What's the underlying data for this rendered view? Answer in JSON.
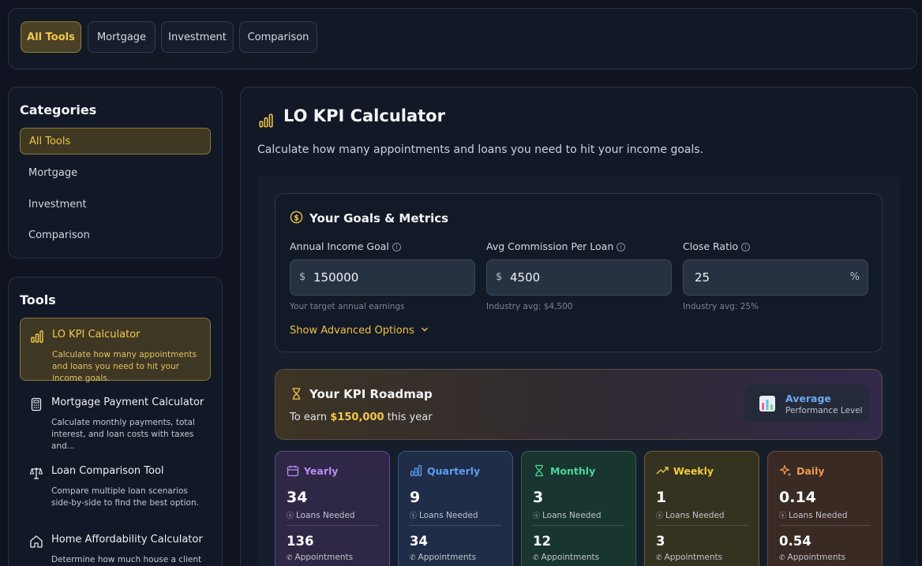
{
  "top_tabs": [
    {
      "label": "All Tools",
      "active": true
    },
    {
      "label": "Mortgage",
      "active": false
    },
    {
      "label": "Investment",
      "active": false
    },
    {
      "label": "Comparison",
      "active": false
    }
  ],
  "categories": {
    "title": "Categories",
    "items": [
      "All Tools",
      "Mortgage",
      "Investment",
      "Comparison"
    ]
  },
  "tools": {
    "title": "Tools",
    "items": [
      {
        "name": "LO KPI Calculator",
        "desc": "Calculate how many appointments and loans you need to hit your income goals.",
        "icon": "bar-chart-icon"
      },
      {
        "name": "Mortgage Payment Calculator",
        "desc": "Calculate monthly payments, total interest, and loan costs with taxes and...",
        "icon": "calculator-icon"
      },
      {
        "name": "Loan Comparison Tool",
        "desc": "Compare multiple loan scenarios side-by-side to find the best option.",
        "icon": "scale-icon"
      },
      {
        "name": "Home Affordability Calculator",
        "desc": "Determine how much house a client can",
        "icon": "home-icon"
      }
    ]
  },
  "calculator": {
    "title": "LO KPI Calculator",
    "description": "Calculate how many appointments and loans you need to hit your income goals."
  },
  "goals": {
    "title": "Your Goals & Metrics",
    "fields": [
      {
        "label": "Annual Income Goal",
        "prefix": "$",
        "value": "150000",
        "suffix": "",
        "hint": "Your target annual earnings"
      },
      {
        "label": "Avg Commission Per Loan",
        "prefix": "$",
        "value": "4500",
        "suffix": "",
        "hint": "Industry avg: $4,500"
      },
      {
        "label": "Close Ratio",
        "prefix": "",
        "value": "25",
        "suffix": "%",
        "hint": "Industry avg: 25%"
      }
    ],
    "advanced_label": "Show Advanced Options"
  },
  "roadmap": {
    "title": "Your KPI Roadmap",
    "subtitle_pre": "To earn",
    "amount": "$150,000",
    "subtitle_post": "this year",
    "performance": "Average",
    "performance_label": "Performance Level"
  },
  "kpis": [
    {
      "name": "Yearly",
      "loans": "34",
      "loans_label": "Loans Needed",
      "appts": "136",
      "appts_label": "Appointments",
      "color": "#b98ef5"
    },
    {
      "name": "Quarterly",
      "loans": "9",
      "loans_label": "Loans Needed",
      "appts": "34",
      "appts_label": "Appointments",
      "color": "#5e9cf3"
    },
    {
      "name": "Monthly",
      "loans": "3",
      "loans_label": "Loans Needed",
      "appts": "12",
      "appts_label": "Appointments",
      "color": "#4cd69a"
    },
    {
      "name": "Weekly",
      "loans": "1",
      "loans_label": "Loans Needed",
      "appts": "3",
      "appts_label": "Appointments",
      "color": "#f2c93f"
    },
    {
      "name": "Daily",
      "loans": "0.14",
      "loans_label": "Loans Needed",
      "appts": "0.54",
      "appts_label": "Appointments",
      "color": "#f39a4d"
    }
  ]
}
